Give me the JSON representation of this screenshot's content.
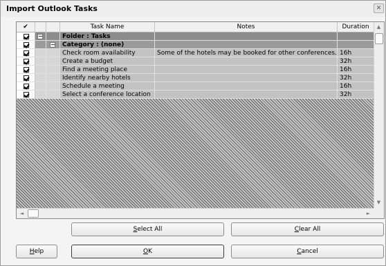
{
  "dialog": {
    "title": "Import Outlook Tasks",
    "close_glyph": "✕"
  },
  "grid": {
    "columns": {
      "check": "✔",
      "task_name": "Task Name",
      "notes": "Notes",
      "duration": "Duration"
    },
    "folder_row": {
      "label": "Folder : Tasks",
      "expand_glyph": "−"
    },
    "category_row": {
      "label": "Category : (none)",
      "expand_glyph": "−"
    },
    "tasks": [
      {
        "checked": true,
        "name": "Check room availability",
        "notes": "Some of the hotels may be booked for other conferences.",
        "duration": "16h"
      },
      {
        "checked": true,
        "name": "Create a budget",
        "notes": "",
        "duration": "32h"
      },
      {
        "checked": true,
        "name": "Find a meeting place",
        "notes": "",
        "duration": "16h"
      },
      {
        "checked": true,
        "name": "Identify nearby hotels",
        "notes": "",
        "duration": "32h"
      },
      {
        "checked": true,
        "name": "Schedule a meeting",
        "notes": "",
        "duration": "16h"
      },
      {
        "checked": true,
        "name": "Select a conference location",
        "notes": "",
        "duration": "32h"
      }
    ]
  },
  "buttons": {
    "select_all": {
      "pre": "",
      "key": "S",
      "post": "elect All"
    },
    "clear_all": {
      "pre": "",
      "key": "C",
      "post": "lear All"
    },
    "help": {
      "pre": "",
      "key": "H",
      "post": "elp"
    },
    "ok": {
      "pre": "",
      "key": "O",
      "post": "K"
    },
    "cancel": {
      "pre": "",
      "key": "C",
      "post": "ancel"
    }
  },
  "scroll": {
    "up": "▲",
    "down": "▼",
    "left": "◄",
    "right": "►"
  }
}
